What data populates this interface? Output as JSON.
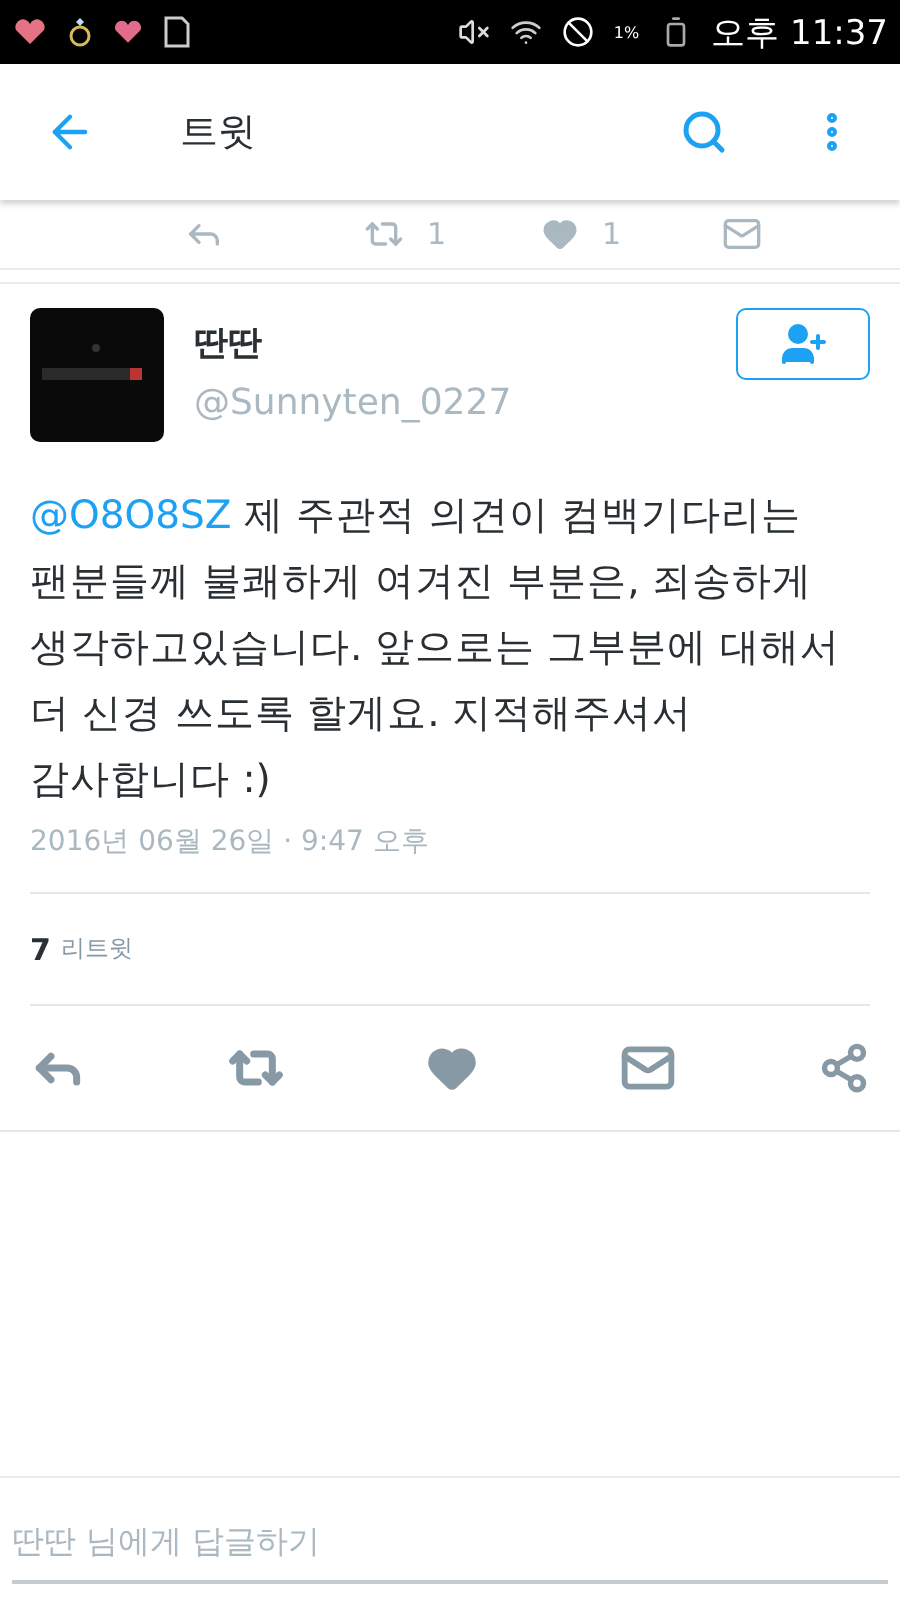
{
  "status_bar": {
    "battery": "1%",
    "time": "오후 11:37"
  },
  "app_bar": {
    "title": "트윗"
  },
  "previous_tweet_actions": {
    "retweets": "1",
    "likes": "1"
  },
  "tweet": {
    "name": "딴딴",
    "handle": "@Sunnyten_0227",
    "mention": "@O8O8SZ",
    "text": " 제 주관적 의견이 컴백기다리는 팬분들께 불쾌하게 여겨진 부분은, 죄송하게 생각하고있습니다. 앞으로는 그부분에 대해서 더 신경 쓰도록 할게요. 지적해주셔서 감사합니다 :)",
    "timestamp": "2016년 06월 26일 · 9:47 오후",
    "retweet_count": "7",
    "retweet_label": "리트윗"
  },
  "reply_field": {
    "placeholder": "딴딴 님에게 답글하기"
  }
}
